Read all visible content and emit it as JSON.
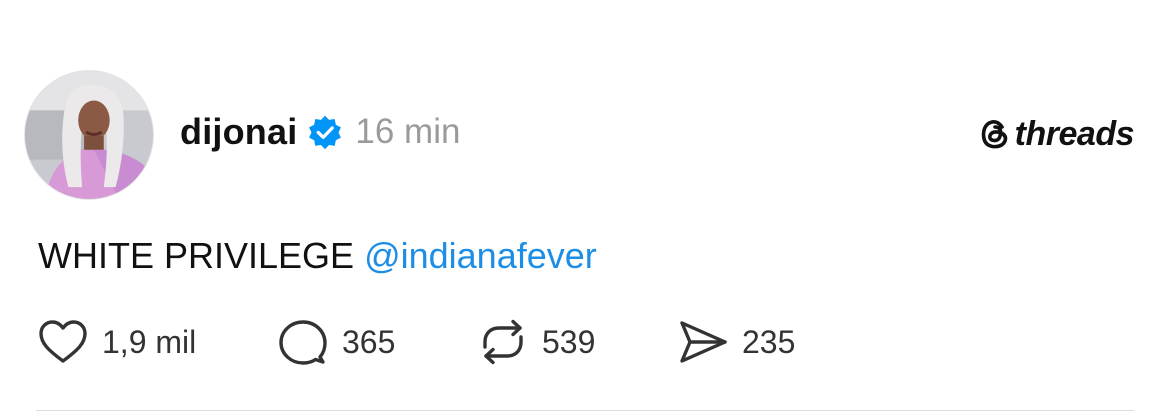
{
  "post": {
    "author": {
      "username": "dijonai",
      "verified": true,
      "timestamp": "16 min",
      "avatar_icon": "profile-photo"
    },
    "brand": {
      "name": "threads",
      "icon": "threads-logo-icon"
    },
    "text": "WHITE PRIVILEGE",
    "mention": "@indianafever",
    "actions": {
      "like": {
        "count": "1,9 mil",
        "icon": "heart-icon"
      },
      "reply": {
        "count": "365",
        "icon": "comment-icon"
      },
      "repost": {
        "count": "539",
        "icon": "repost-icon"
      },
      "share": {
        "count": "235",
        "icon": "send-icon"
      }
    }
  },
  "colors": {
    "mention": "#1d8ee6",
    "verified": "#0095f6",
    "timestamp": "#9a9a9a",
    "text": "#111111",
    "divider": "#dcdcdc"
  }
}
